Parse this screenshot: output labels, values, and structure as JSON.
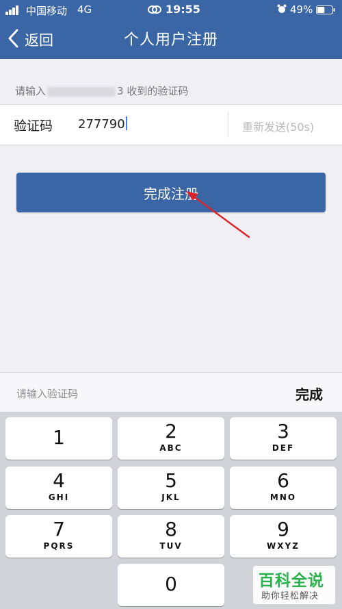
{
  "status": {
    "carrier": "中国移动",
    "network": "4G",
    "time": "19:55",
    "battery": "49%",
    "battery_level": 0.49
  },
  "nav": {
    "back_label": "返回",
    "title": "个人用户注册"
  },
  "form": {
    "hint_prefix": "请输入",
    "hint_suffix": "3 收到的验证码",
    "code_label": "验证码",
    "code_value": "277790",
    "resend_label": "重新发送(50s)",
    "submit_label": "完成注册"
  },
  "keyboard": {
    "placeholder": "请输入验证码",
    "done_label": "完成",
    "keys": [
      {
        "digit": "1",
        "letters": ""
      },
      {
        "digit": "2",
        "letters": "ABC"
      },
      {
        "digit": "3",
        "letters": "DEF"
      },
      {
        "digit": "4",
        "letters": "GHI"
      },
      {
        "digit": "5",
        "letters": "JKL"
      },
      {
        "digit": "6",
        "letters": "MNO"
      },
      {
        "digit": "7",
        "letters": "PQRS"
      },
      {
        "digit": "8",
        "letters": "TUV"
      },
      {
        "digit": "9",
        "letters": "WXYZ"
      },
      {
        "digit": "0",
        "letters": ""
      }
    ]
  },
  "watermark": {
    "title": "百科全说",
    "subtitle": "助你轻松解决"
  },
  "colors": {
    "brand": "#3b66a6",
    "arrow": "#d9242b",
    "watermark": "#2ab34a"
  },
  "icons": [
    "signal-icon",
    "link-icon",
    "alarm-icon",
    "battery-icon",
    "chevron-left-icon",
    "arrow-annotation"
  ]
}
